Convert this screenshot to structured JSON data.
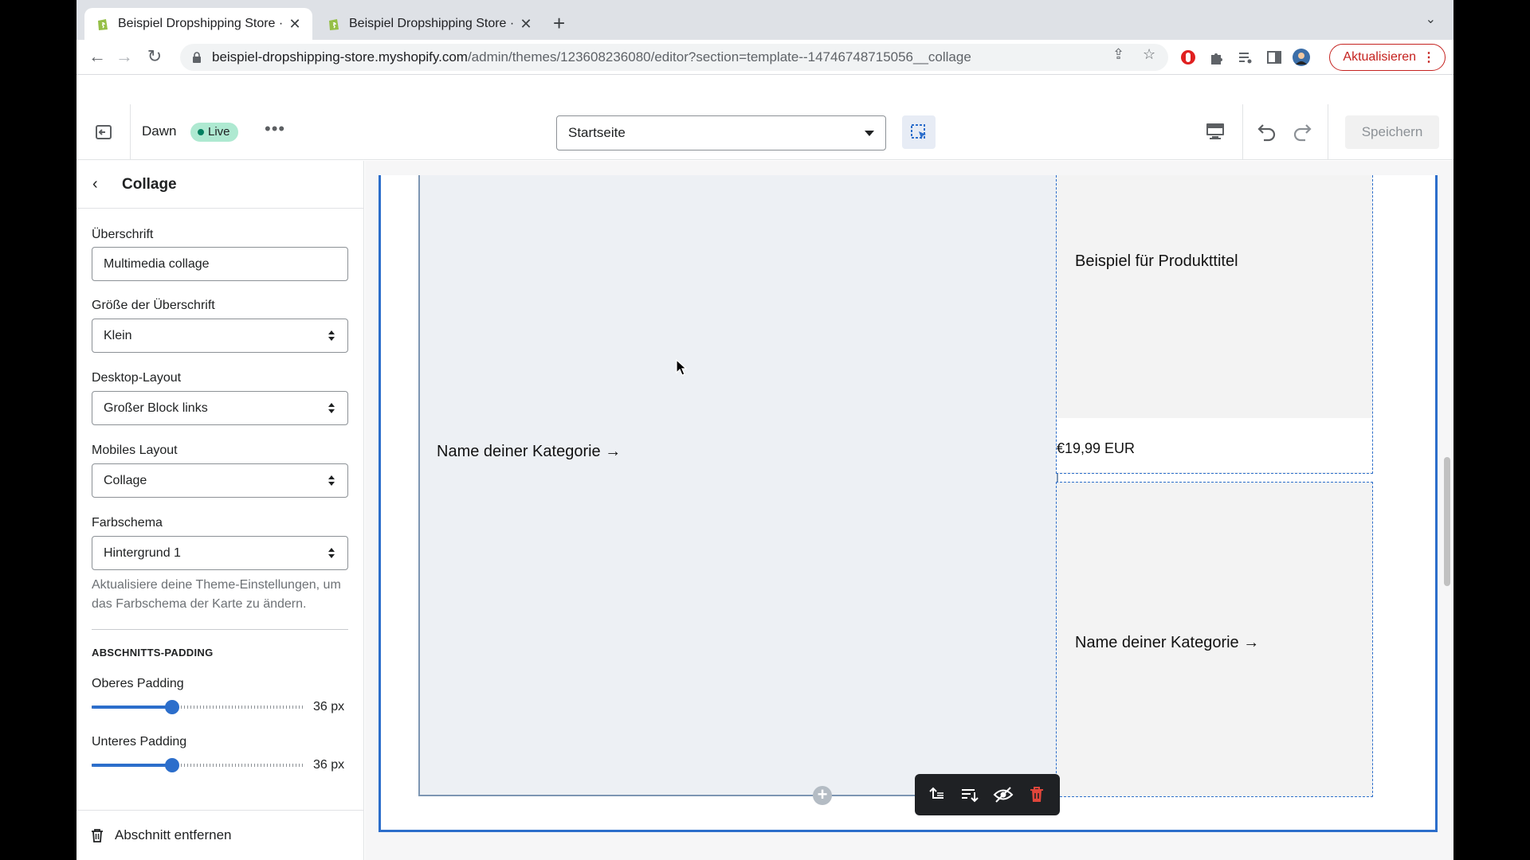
{
  "browser": {
    "tabs": [
      {
        "title": "Beispiel Dropshipping Store · D",
        "active": true
      },
      {
        "title": "Beispiel Dropshipping Store · B",
        "active": false
      }
    ],
    "url_host": "beispiel-dropshipping-store.myshopify.com",
    "url_path": "/admin/themes/123608236080/editor?section=template--14746748715056__collage",
    "update_button": "Aktualisieren"
  },
  "header": {
    "theme_name": "Dawn",
    "live_badge": "Live",
    "template_select": "Startseite",
    "save_button": "Speichern"
  },
  "sidebar": {
    "title": "Collage",
    "heading_label": "Überschrift",
    "heading_value": "Multimedia collage",
    "heading_size_label": "Größe der Überschrift",
    "heading_size_value": "Klein",
    "desktop_layout_label": "Desktop-Layout",
    "desktop_layout_value": "Großer Block links",
    "mobile_layout_label": "Mobiles Layout",
    "mobile_layout_value": "Collage",
    "color_scheme_label": "Farbschema",
    "color_scheme_value": "Hintergrund 1",
    "color_scheme_help": "Aktualisiere deine Theme-Einstellungen, um das Farbschema der Karte zu ändern.",
    "padding_heading": "ABSCHNITTS-PADDING",
    "top_padding_label": "Oberes Padding",
    "top_padding_value": "36 px",
    "top_padding_fraction": 0.375,
    "bottom_padding_label": "Unteres Padding",
    "bottom_padding_value": "36 px",
    "bottom_padding_fraction": 0.375,
    "remove_section": "Abschnitt entfernen"
  },
  "preview": {
    "big_block_label": "Name deiner Kategorie →",
    "product_title": "Beispiel für Produkttitel",
    "product_price": "€19,99 EUR",
    "category_label": "Name deiner Kategorie →"
  },
  "colors": {
    "accent": "#2c6ecb",
    "live_badge_bg": "#aee9d1",
    "delete_red": "#e0463b",
    "update_red": "#c5221f"
  }
}
